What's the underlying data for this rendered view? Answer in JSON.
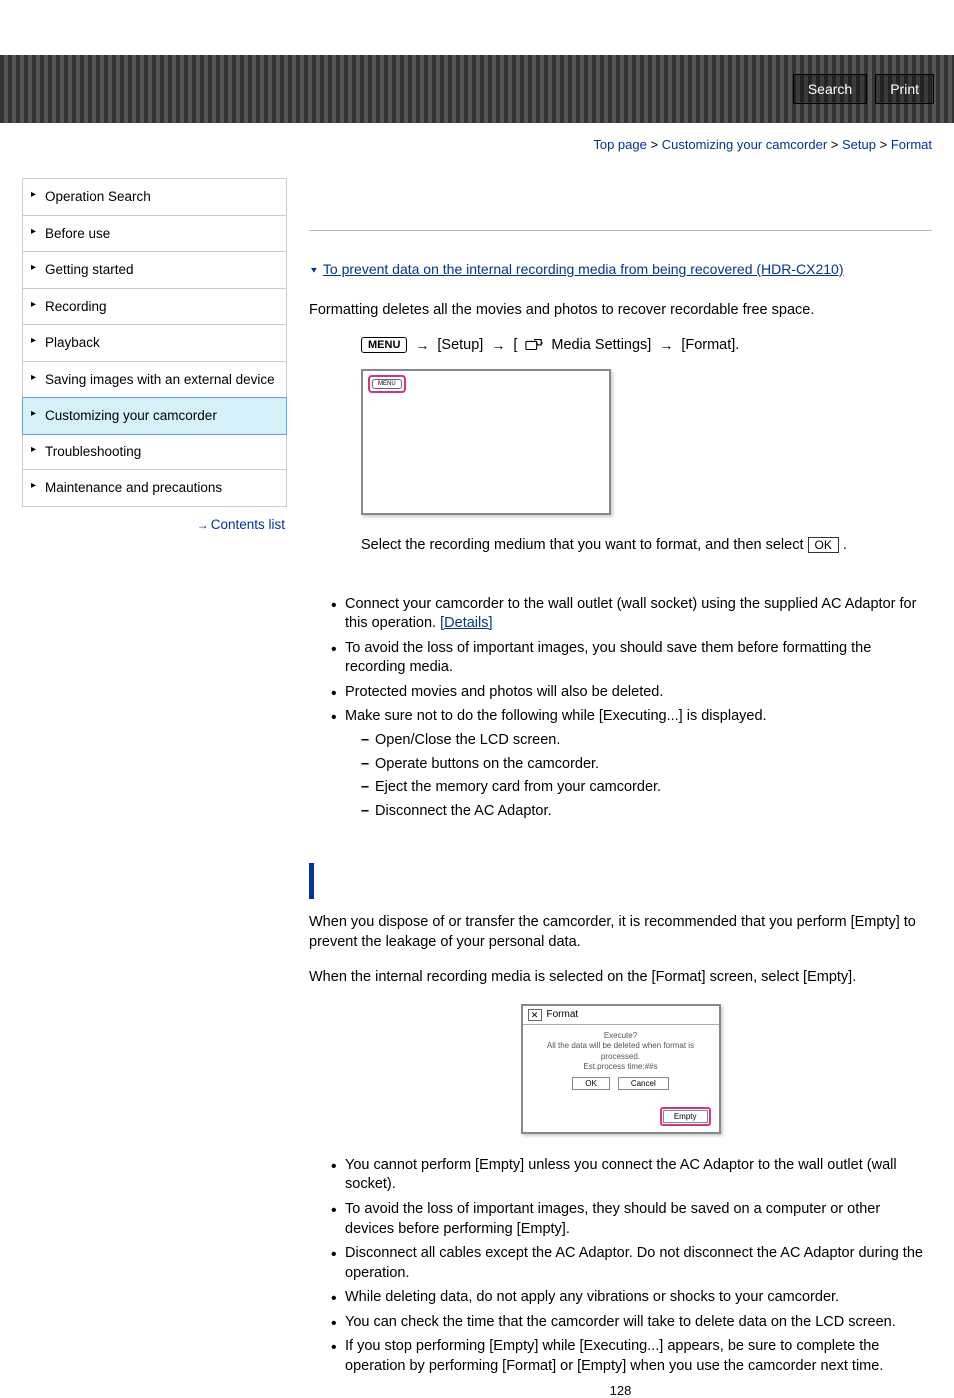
{
  "header": {
    "search": "Search",
    "print": "Print"
  },
  "breadcrumb": {
    "top": "Top page",
    "customizing": "Customizing your camcorder",
    "setup": "Setup",
    "format": "Format",
    "sep": ">"
  },
  "sidebar": {
    "items": [
      "Operation Search",
      "Before use",
      "Getting started",
      "Recording",
      "Playback",
      "Saving images with an external device",
      "Customizing your camcorder",
      "Troubleshooting",
      "Maintenance and precautions"
    ],
    "contents": "Contents list"
  },
  "main": {
    "toc_link": "To prevent data on the internal recording media from being recovered (HDR-CX210)",
    "intro": "Formatting deletes all the movies and photos to recover recordable free space.",
    "menu_label": "MENU",
    "path_setup": "[Setup]",
    "path_media": "Media Settings]",
    "path_bracket": "[",
    "path_format": "[Format].",
    "mock_menu": "MENU",
    "select_text_a": "Select the recording medium that you want to format, and then select ",
    "ok": "OK",
    "select_text_b": ".",
    "notes1": [
      "Connect your camcorder to the wall outlet (wall socket) using the supplied AC Adaptor for this operation. ",
      "To avoid the loss of important images, you should save them before formatting the recording media.",
      "Protected movies and photos will also be deleted.",
      "Make sure not to do the following while [Executing...] is displayed."
    ],
    "details": "[Details]",
    "dashes": [
      "Open/Close the LCD screen.",
      "Operate buttons on the camcorder.",
      "Eject the memory card from your camcorder.",
      "Disconnect the AC Adaptor."
    ],
    "para2": "When you dispose of or transfer the camcorder, it is recommended that you perform [Empty] to prevent the leakage of your personal data.",
    "para3": "When the internal recording media is selected on the [Format] screen, select [Empty].",
    "dialog": {
      "title": "Format",
      "line1": "Execute?",
      "line2": "All the data will be deleted when format is processed.",
      "line3": "Est.process time:##s",
      "ok": "OK",
      "cancel": "Cancel",
      "empty": "Empty"
    },
    "notes2": [
      "You cannot perform [Empty] unless you connect the AC Adaptor to the wall outlet (wall socket).",
      "To avoid the loss of important images, they should be saved on a computer or other devices before performing [Empty].",
      "Disconnect all cables except the AC Adaptor. Do not disconnect the AC Adaptor during the operation.",
      "While deleting data, do not apply any vibrations or shocks to your camcorder.",
      "You can check the time that the camcorder will take to delete data on the LCD screen.",
      "If you stop performing [Empty] while [Executing...] appears, be sure to complete the operation by performing [Format] or [Empty] when you use the camcorder next time."
    ],
    "page": "128"
  }
}
